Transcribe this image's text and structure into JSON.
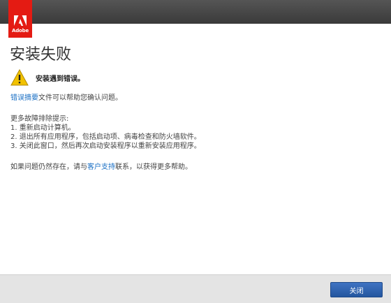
{
  "logo": {
    "text": "Adobe",
    "color": "#e41b13"
  },
  "dialog": {
    "title": "安装失败",
    "warning": {
      "icon": "warning-icon",
      "text": "安装遇到错误。"
    },
    "summary": {
      "link": "错误摘要",
      "rest": "文件可以帮助您确认问题。"
    },
    "troubleshoot": {
      "heading": "更多故障排除提示:",
      "steps": [
        "1. 重新启动计算机。",
        "2. 退出所有应用程序，包括启动项、病毒检查和防火墙软件。",
        "3. 关闭此窗口，然后再次启动安装程序以重新安装应用程序。"
      ]
    },
    "support": {
      "pre": "如果问题仍然存在，请与",
      "link": "客户支持",
      "post": "联系，以获得更多帮助。"
    }
  },
  "footer": {
    "close_label": "关闭"
  },
  "colors": {
    "accent": "#1a6fc4",
    "button": "#2e63b3",
    "warning": "#f2c200"
  }
}
